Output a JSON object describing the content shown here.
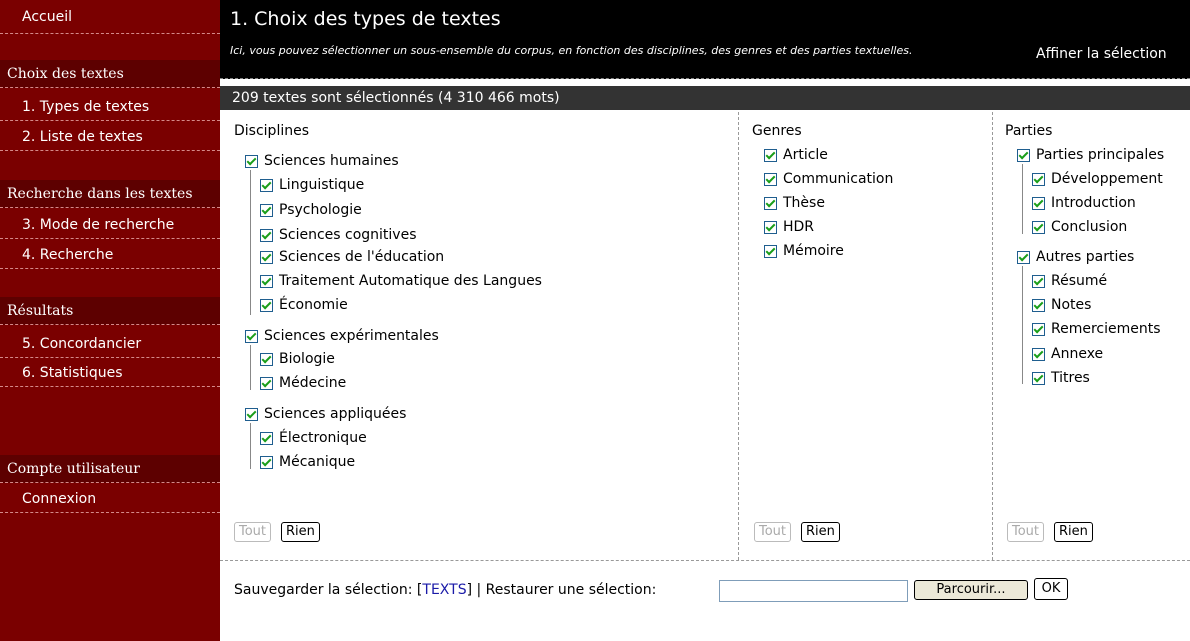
{
  "sidebar": {
    "home": "Accueil",
    "sections": [
      {
        "title": "Choix des textes",
        "items": [
          "1. Types de textes",
          "2. Liste de textes"
        ]
      },
      {
        "title": "Recherche dans les textes",
        "items": [
          "3. Mode de recherche",
          "4. Recherche"
        ]
      },
      {
        "title": "Résultats",
        "items": [
          "5. Concordancier",
          "6. Statistiques"
        ]
      },
      {
        "title": "Compte utilisateur",
        "items": [
          "Connexion"
        ]
      }
    ]
  },
  "header": {
    "title": "1. Choix des types de textes",
    "description": "Ici, vous pouvez sélectionner un sous-ensemble du corpus, en fonction des disciplines, des genres et des parties textuelles.",
    "refine": "Affiner la sélection"
  },
  "count": "209 textes sont sélectionnés (4 310 466 mots)",
  "disciplines": {
    "heading": "Disciplines",
    "groups": [
      {
        "label": "Sciences humaines",
        "checked": true,
        "items": [
          "Linguistique",
          "Psychologie",
          "Sciences cognitives",
          "Sciences de l'éducation",
          "Traitement Automatique des Langues",
          "Économie"
        ]
      },
      {
        "label": "Sciences expérimentales",
        "checked": true,
        "items": [
          "Biologie",
          "Médecine"
        ]
      },
      {
        "label": "Sciences appliquées",
        "checked": true,
        "items": [
          "Électronique",
          "Mécanique"
        ]
      }
    ]
  },
  "genres": {
    "heading": "Genres",
    "items": [
      "Article",
      "Communication",
      "Thèse",
      "HDR",
      "Mémoire"
    ]
  },
  "parties": {
    "heading": "Parties",
    "groups": [
      {
        "label": "Parties principales",
        "checked": true,
        "items": [
          "Développement",
          "Introduction",
          "Conclusion"
        ]
      },
      {
        "label": "Autres parties",
        "checked": true,
        "items": [
          "Résumé",
          "Notes",
          "Remerciements",
          "Annexe",
          "Titres"
        ]
      }
    ]
  },
  "buttons": {
    "all": "Tout",
    "none": "Rien"
  },
  "footer": {
    "save_label": "Sauvegarder la sélection: [",
    "save_link": "TEXTS",
    "restore_label": "] | Restaurer une sélection:",
    "browse": "Parcourir...",
    "ok": "OK"
  },
  "colors": {
    "sidebar": "#7a0000",
    "sidebar_section": "#5d0000",
    "header": "#000000",
    "countbar": "#333333",
    "check": "#1a9e1a"
  }
}
